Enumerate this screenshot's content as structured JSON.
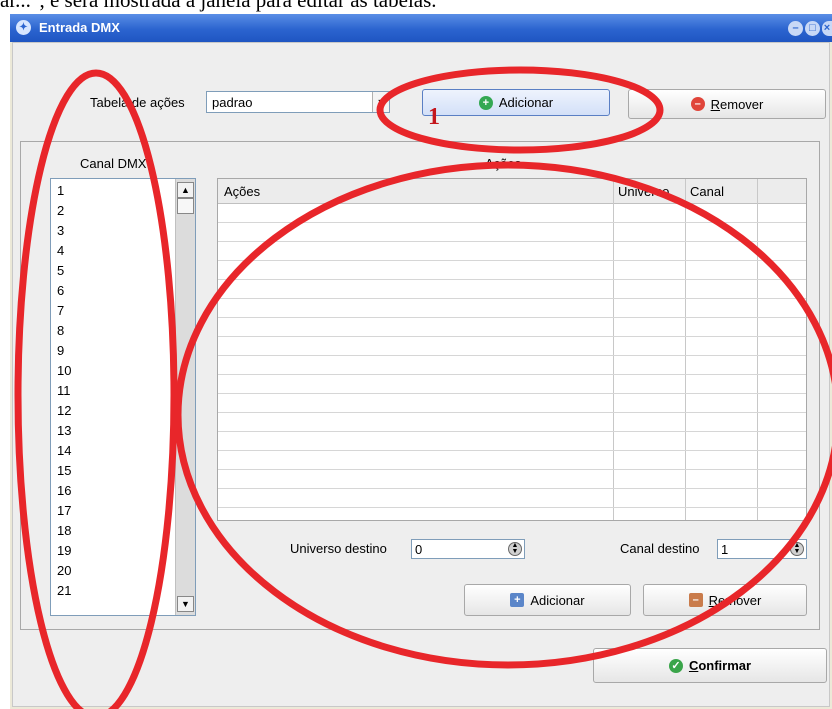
{
  "caption": "ar...\", e será mostrada a janela para editar as tabelas.",
  "window": {
    "title": "Entrada DMX",
    "title_icon": "app-icon",
    "controls": [
      "minimize-icon",
      "maximize-icon",
      "close-icon"
    ]
  },
  "top": {
    "table_label": "Tabela de ações",
    "table_value": "padrao",
    "add_label": "Adicionar",
    "remove_label": "Remover",
    "remove_hotkey": "R",
    "remove_rest": "emover"
  },
  "dmx": {
    "header": "Canal DMX",
    "channels": [
      "1",
      "2",
      "3",
      "4",
      "5",
      "6",
      "7",
      "8",
      "9",
      "10",
      "11",
      "12",
      "13",
      "14",
      "15",
      "16",
      "17",
      "18",
      "19",
      "20",
      "21"
    ]
  },
  "actions": {
    "header": "Ações",
    "columns": [
      "Ações",
      "Universo",
      "Canal"
    ]
  },
  "bottom": {
    "universe_label": "Universo destino",
    "universe_value": "0",
    "channel_label": "Canal destino",
    "channel_value": "1",
    "add_label": "Adicionar",
    "remove_hotkey": "R",
    "remove_rest": "emover"
  },
  "confirm": {
    "hotkey": "C",
    "rest": "onfirmar"
  },
  "annotation": {
    "marker": "1",
    "color": "#e8262a"
  },
  "colors": {
    "title_bar": "#2b64cf",
    "client_bg": "#eeeeee",
    "add_highlight": "#dce7fb"
  }
}
